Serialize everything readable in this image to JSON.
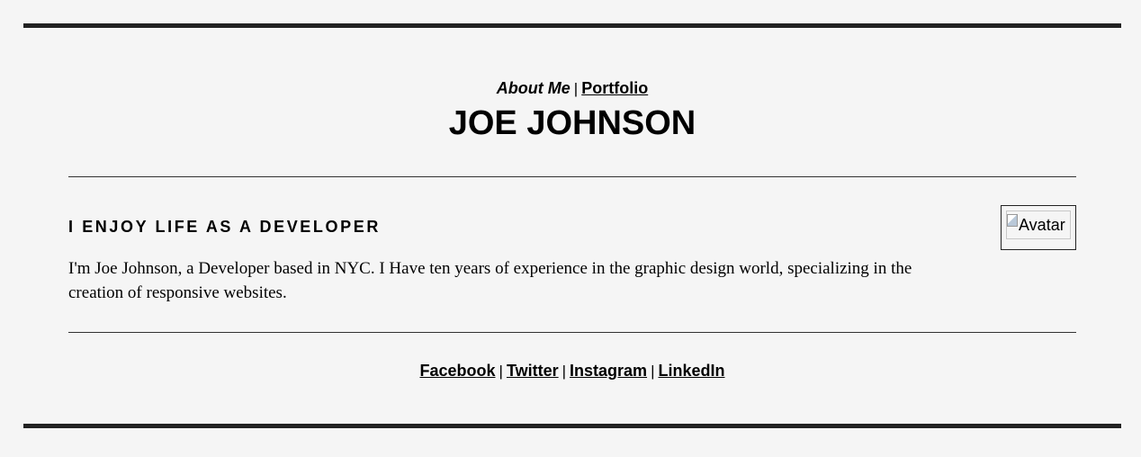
{
  "nav": {
    "about_label": "About Me",
    "separator": "|",
    "portfolio_label": "Portfolio"
  },
  "header": {
    "name": "JOE JOHNSON"
  },
  "intro": {
    "headline": "I ENJOY LIFE AS A DEVELOPER",
    "bio": "I'm Joe Johnson, a Developer based in NYC. I Have ten years of experience in the graphic design world, specializing in the creation of responsive websites.",
    "avatar_alt": "Avatar",
    "avatar_icon": "broken-image-icon"
  },
  "social": {
    "separator": "|",
    "links": [
      "Facebook",
      "Twitter",
      "Instagram",
      "LinkedIn"
    ]
  },
  "colors": {
    "background": "#f5f5f5",
    "border": "#222222",
    "text": "#000000"
  }
}
